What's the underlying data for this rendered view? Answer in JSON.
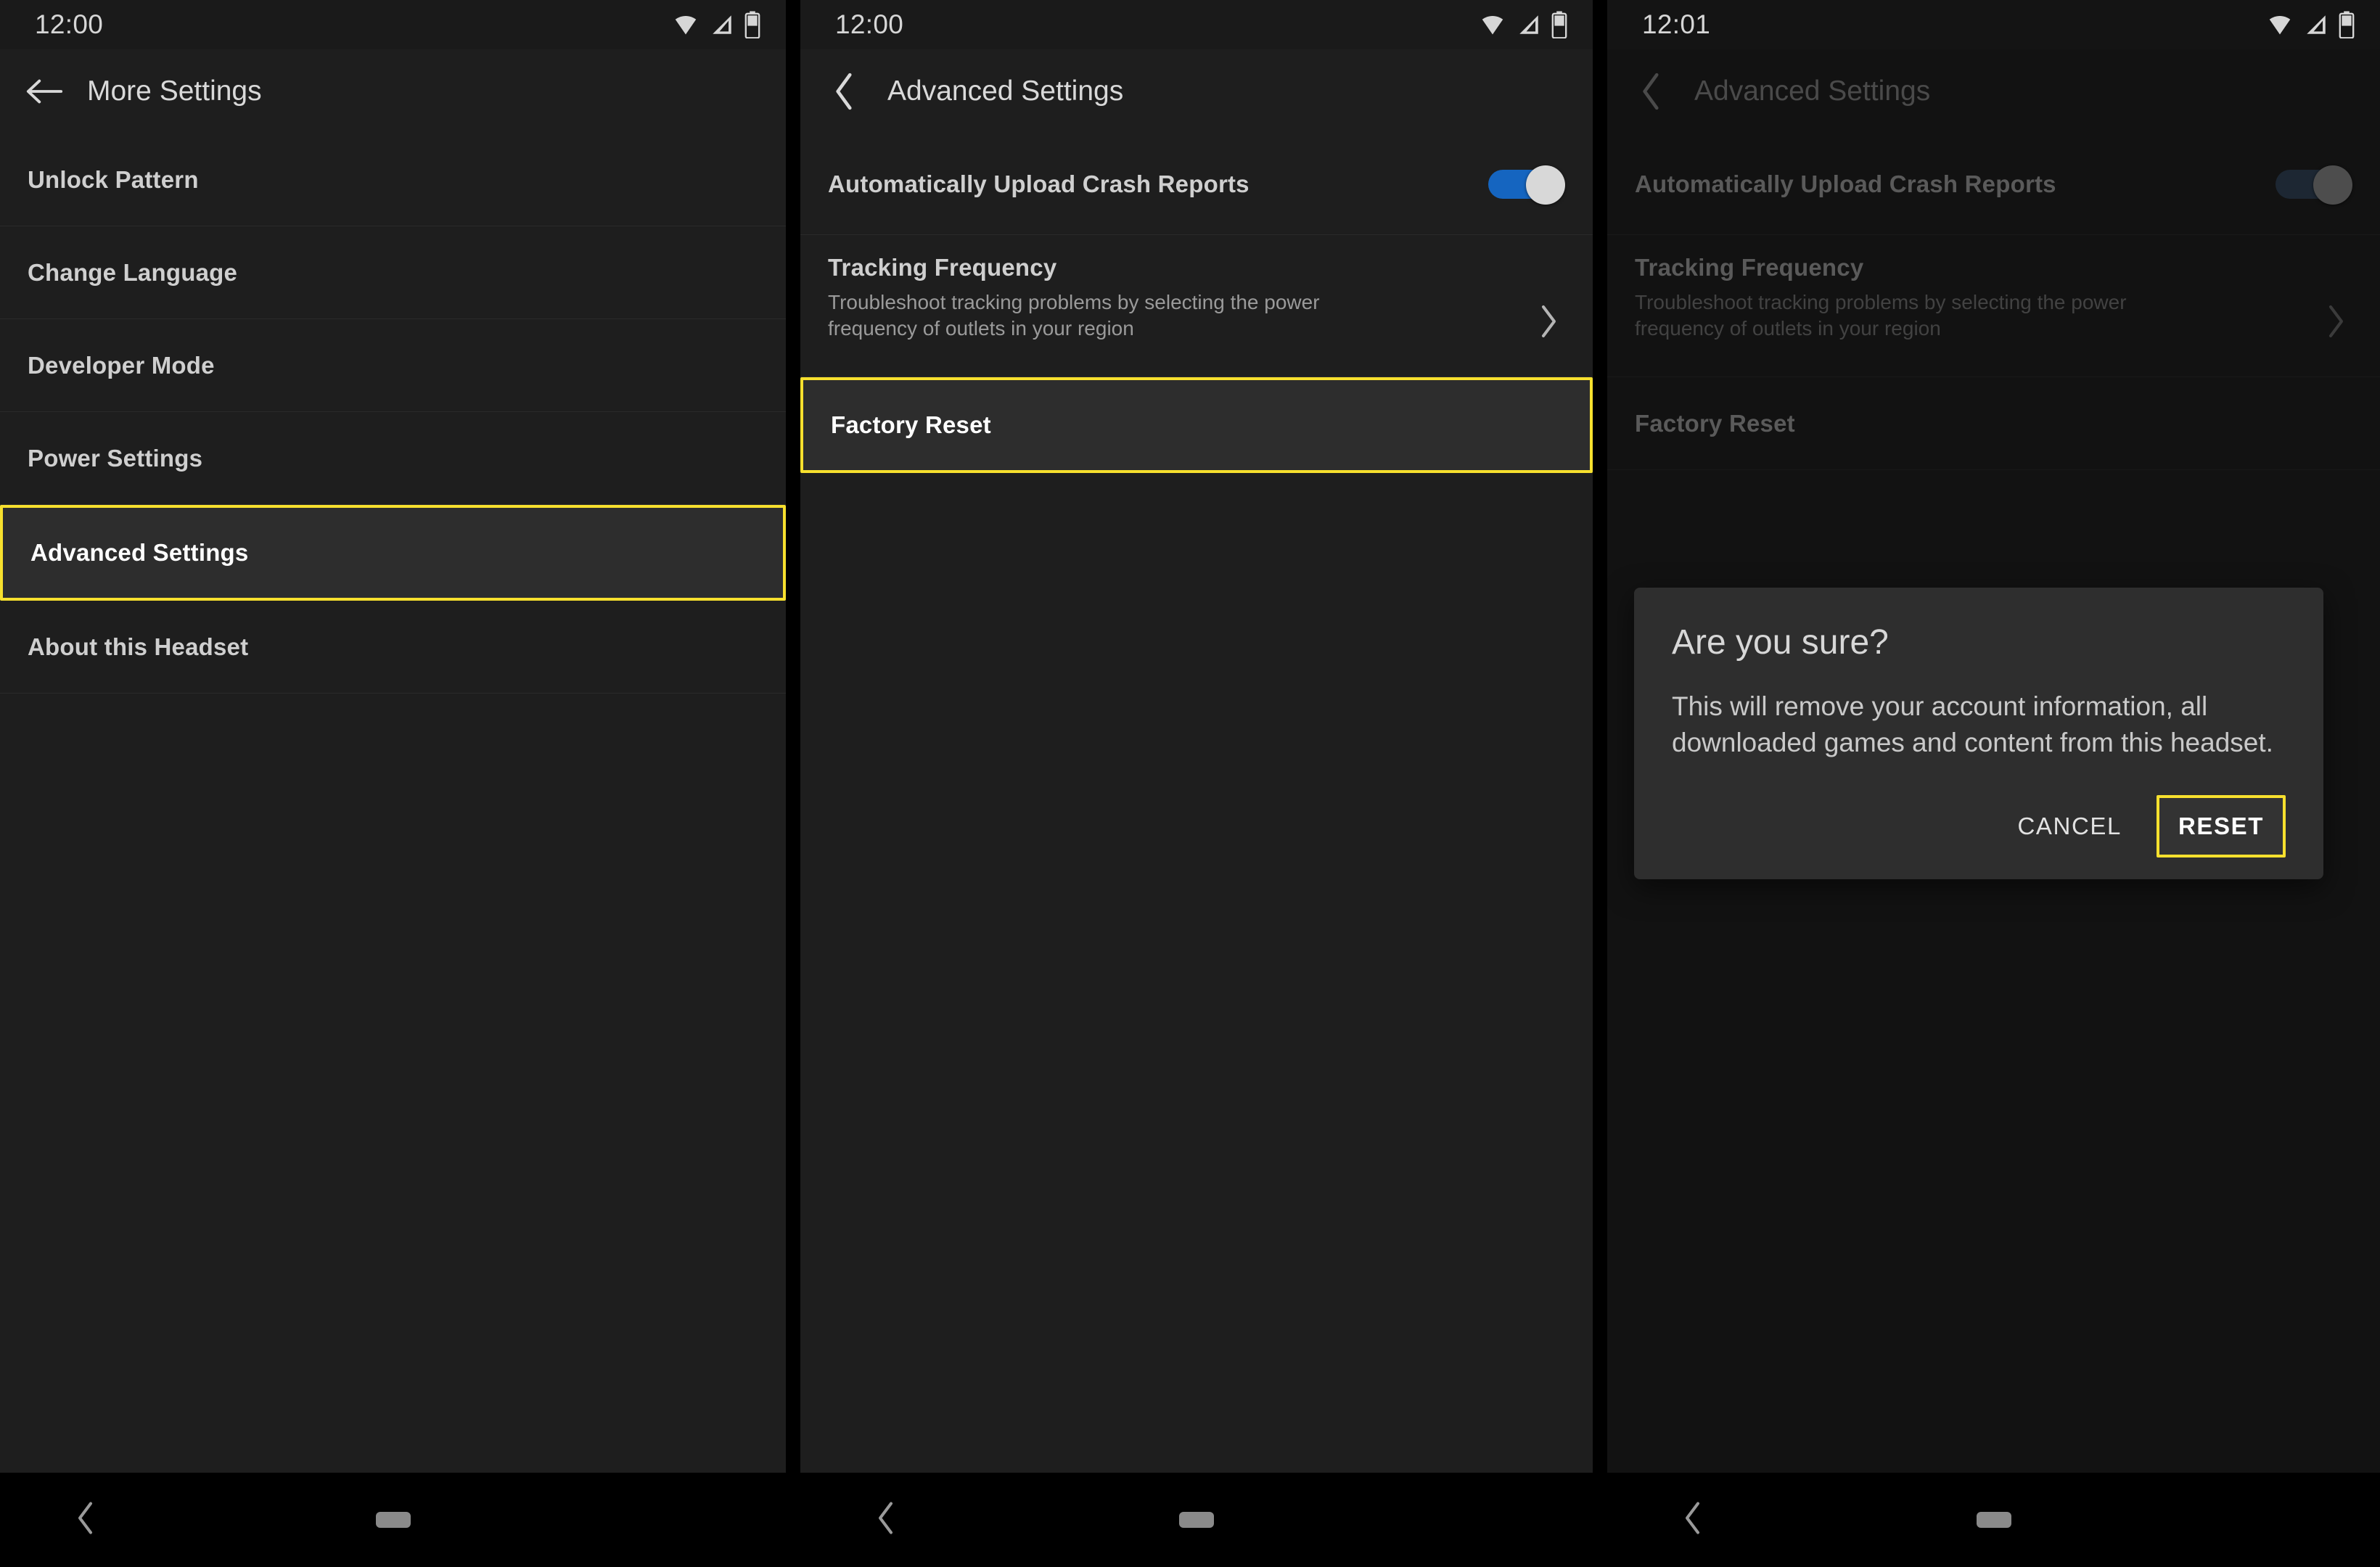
{
  "screens": [
    {
      "id": "more-settings",
      "status": {
        "time": "12:00",
        "icons": [
          "wifi-icon",
          "signal-icon",
          "battery-icon"
        ]
      },
      "appbar": {
        "title": "More Settings",
        "back_icon": "arrow-left-icon"
      },
      "items": [
        {
          "label": "Unlock Pattern",
          "highlighted": false
        },
        {
          "label": "Change Language",
          "highlighted": false
        },
        {
          "label": "Developer Mode",
          "highlighted": false
        },
        {
          "label": "Power Settings",
          "highlighted": false
        },
        {
          "label": "Advanced Settings",
          "highlighted": true
        },
        {
          "label": "About this Headset",
          "highlighted": false
        }
      ],
      "navbar": {
        "back_icon": "chevron-left-icon",
        "home_pill": "home-pill"
      }
    },
    {
      "id": "advanced-settings",
      "status": {
        "time": "12:00",
        "icons": [
          "wifi-icon",
          "signal-icon",
          "battery-icon"
        ]
      },
      "appbar": {
        "title": "Advanced Settings",
        "back_icon": "chevron-left-icon"
      },
      "crash_reports": {
        "label": "Automatically Upload Crash Reports",
        "toggle_on": true
      },
      "tracking": {
        "label": "Tracking Frequency",
        "description": "Troubleshoot tracking problems by selecting the power frequency of outlets in your region",
        "chevron_icon": "chevron-right-icon"
      },
      "factory_reset": {
        "label": "Factory Reset",
        "highlighted": true
      },
      "navbar": {
        "back_icon": "chevron-left-icon",
        "home_pill": "home-pill"
      }
    },
    {
      "id": "advanced-settings-dialog",
      "status": {
        "time": "12:01",
        "icons": [
          "wifi-icon",
          "signal-icon",
          "battery-icon"
        ]
      },
      "appbar": {
        "title": "Advanced Settings",
        "back_icon": "chevron-left-icon"
      },
      "crash_reports": {
        "label": "Automatically Upload Crash Reports",
        "toggle_on": true
      },
      "tracking": {
        "label": "Tracking Frequency",
        "description": "Troubleshoot tracking problems by selecting the power frequency of outlets in your region",
        "chevron_icon": "chevron-right-icon"
      },
      "factory_reset": {
        "label": "Factory Reset",
        "highlighted": false
      },
      "dialog": {
        "title": "Are you sure?",
        "body": "This will remove your account information, all downloaded games and content from this headset.",
        "cancel_label": "CANCEL",
        "confirm_label": "RESET",
        "confirm_highlighted": true
      },
      "navbar": {
        "back_icon": "chevron-left-icon",
        "home_pill": "home-pill"
      }
    }
  ],
  "colors": {
    "highlight": "#f7e02e",
    "toggle_on": "#1565c0",
    "toggle_thumb": "#d8d8d8",
    "screen_bg": "#1e1e1e",
    "dimmed_bg": "#121212",
    "dialog_bg": "#2e2e2e"
  }
}
